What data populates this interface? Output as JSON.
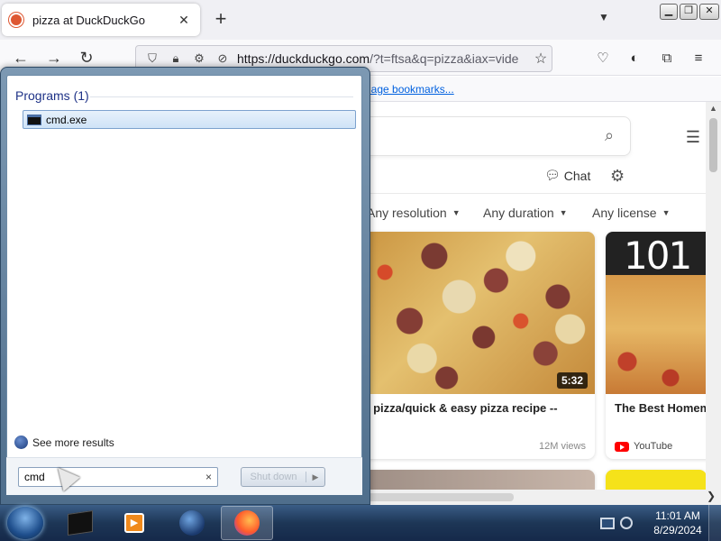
{
  "browser": {
    "tab_title": "pizza at DuckDuckGo",
    "tab_close": "✕",
    "new_tab": "+",
    "url_domain": "https://duckduckgo.com",
    "url_rest": "/?t=ftsa&q=pizza&iax=vide",
    "bookmark_link": "nage bookmarks..."
  },
  "page": {
    "chat_label": "Chat",
    "filters": [
      "Any resolution",
      "Any duration",
      "Any license"
    ],
    "cards": [
      {
        "title": "ke pizza/quick & easy pizza recipe --",
        "duration": "5:32",
        "views": "12M views"
      },
      {
        "title": "The Best Homem",
        "thumb_text": "101",
        "source": "YouTube"
      }
    ]
  },
  "start_menu": {
    "header": "Programs (1)",
    "result": "cmd.exe",
    "see_more": "See more results",
    "search_value": "cmd",
    "clear": "×",
    "shutdown_label": "Shut down"
  },
  "taskbar": {
    "time": "11:01 AM",
    "date": "8/29/2024"
  },
  "icons": {
    "accent": "#0060df",
    "duckduckgo": "#de5833"
  }
}
